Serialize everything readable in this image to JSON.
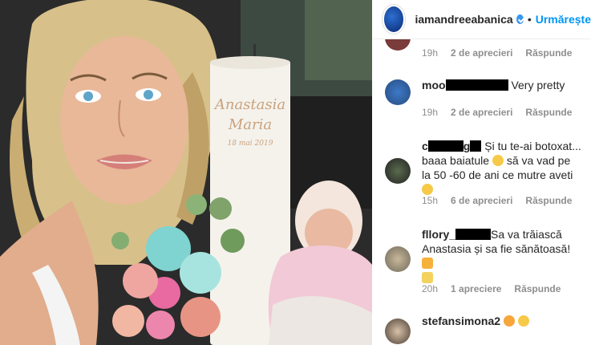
{
  "header": {
    "username": "iamandreeabanica",
    "separator": "•",
    "follow_label": "Urmărește"
  },
  "comments": [
    {
      "username": "",
      "text": "",
      "time": "19h",
      "likes": "2 de aprecieri",
      "reply": "Răspunde"
    },
    {
      "username": "moo",
      "text": " Very pretty",
      "time": "19h",
      "likes": "2 de aprecieri",
      "reply": "Răspunde"
    },
    {
      "username": "c",
      "username_end": "g",
      "text": "Și tu te-ai botoxat... baaa baiatule",
      "text2": " să va vad pe la 50 -60 de ani ce mutre aveti",
      "time": "15h",
      "likes": "6 de aprecieri",
      "reply": "Răspunde"
    },
    {
      "username": "fllory_",
      "text": "Sa va trăiască Anastasia și sa fie sănătoasă!",
      "time": "20h",
      "likes": "1 apreciere",
      "reply": "Răspunde"
    },
    {
      "username": "stefansimona2",
      "text": "",
      "time": "",
      "likes": "",
      "reply": ""
    }
  ],
  "photo": {
    "candle_lines": [
      "Anastasia",
      "Maria",
      "18 mai 2019"
    ]
  },
  "colors": {
    "accent": "#0095f6",
    "meta": "#8e8e8e",
    "text": "#262626"
  }
}
